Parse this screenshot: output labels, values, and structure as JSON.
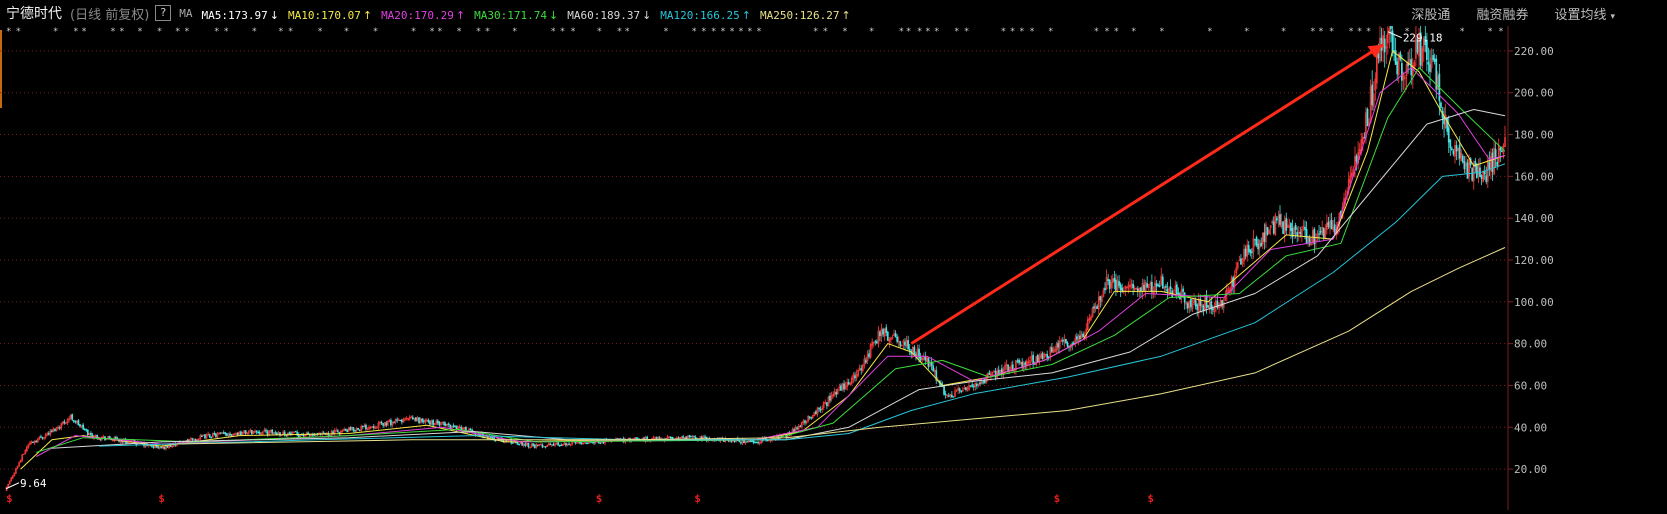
{
  "header": {
    "stock_name": "宁德时代",
    "period_label": "(日线 前复权)",
    "help": "?",
    "ma_label": "MA",
    "ma_items": [
      {
        "label": "MA5:173.97",
        "arrow": "↓",
        "color": "#ffffff"
      },
      {
        "label": "MA10:170.07",
        "arrow": "↑",
        "color": "#f5e94a"
      },
      {
        "label": "MA20:170.29",
        "arrow": "↑",
        "color": "#e040e0"
      },
      {
        "label": "MA30:171.74",
        "arrow": "↓",
        "color": "#3ddc3d"
      },
      {
        "label": "MA60:189.37",
        "arrow": "↓",
        "color": "#d8d8d8"
      },
      {
        "label": "MA120:166.25",
        "arrow": "↑",
        "color": "#26c6da"
      },
      {
        "label": "MA250:126.27",
        "arrow": "↑",
        "color": "#e8e08a"
      }
    ],
    "menu": [
      {
        "label": "深股通"
      },
      {
        "label": "融资融券"
      },
      {
        "label": "设置均线",
        "caret": "▾"
      }
    ]
  },
  "colors": {
    "up": "#ff3b3b",
    "down": "#47e6e6",
    "grid": "#7a1f1f",
    "axis_text": "#bfbfbf",
    "event_marker": "#e02020"
  },
  "chart_data": {
    "type": "line",
    "ylim": [
      10,
      230
    ],
    "yticks": [
      20,
      40,
      60,
      80,
      100,
      120,
      140,
      160,
      180,
      200,
      220
    ],
    "ytick_labels": [
      "20.00",
      "40.00",
      "60.00",
      "80.00",
      "100.00",
      "120.00",
      "140.00",
      "160.00",
      "180.00",
      "200.00",
      "220.00"
    ],
    "x_start": 0,
    "x_end": 1000,
    "price_keypoints": [
      [
        0,
        9.64
      ],
      [
        15,
        32
      ],
      [
        30,
        38
      ],
      [
        42,
        45
      ],
      [
        55,
        36
      ],
      [
        80,
        33
      ],
      [
        100,
        30
      ],
      [
        130,
        36
      ],
      [
        160,
        38
      ],
      [
        200,
        36
      ],
      [
        230,
        40
      ],
      [
        260,
        44
      ],
      [
        290,
        40
      ],
      [
        310,
        35
      ],
      [
        340,
        31
      ],
      [
        370,
        33
      ],
      [
        400,
        34
      ],
      [
        440,
        35
      ],
      [
        480,
        33
      ],
      [
        500,
        36
      ],
      [
        520,
        48
      ],
      [
        545,
        65
      ],
      [
        560,
        86
      ],
      [
        575,
        80
      ],
      [
        590,
        72
      ],
      [
        603,
        55
      ],
      [
        620,
        60
      ],
      [
        640,
        68
      ],
      [
        665,
        74
      ],
      [
        690,
        85
      ],
      [
        705,
        110
      ],
      [
        720,
        105
      ],
      [
        740,
        110
      ],
      [
        760,
        98
      ],
      [
        780,
        100
      ],
      [
        795,
        125
      ],
      [
        815,
        138
      ],
      [
        840,
        130
      ],
      [
        855,
        140
      ],
      [
        870,
        180
      ],
      [
        880,
        220
      ],
      [
        885,
        229.18
      ],
      [
        895,
        205
      ],
      [
        905,
        222
      ],
      [
        915,
        210
      ],
      [
        925,
        175
      ],
      [
        935,
        165
      ],
      [
        945,
        160
      ],
      [
        955,
        170
      ],
      [
        960,
        173
      ]
    ],
    "series": [
      {
        "name": "MA10",
        "color": "#f5e94a",
        "values": [
          [
            10,
            20
          ],
          [
            30,
            34
          ],
          [
            50,
            36
          ],
          [
            100,
            31
          ],
          [
            150,
            36
          ],
          [
            220,
            37
          ],
          [
            270,
            41
          ],
          [
            320,
            33
          ],
          [
            400,
            34
          ],
          [
            480,
            34
          ],
          [
            510,
            38
          ],
          [
            540,
            55
          ],
          [
            565,
            80
          ],
          [
            580,
            76
          ],
          [
            600,
            60
          ],
          [
            630,
            64
          ],
          [
            665,
            72
          ],
          [
            690,
            82
          ],
          [
            710,
            105
          ],
          [
            740,
            105
          ],
          [
            770,
            100
          ],
          [
            795,
            116
          ],
          [
            820,
            132
          ],
          [
            850,
            130
          ],
          [
            872,
            172
          ],
          [
            888,
            220
          ],
          [
            905,
            210
          ],
          [
            920,
            190
          ],
          [
            940,
            165
          ],
          [
            960,
            170
          ]
        ]
      },
      {
        "name": "MA20",
        "color": "#e040e0",
        "values": [
          [
            20,
            26
          ],
          [
            45,
            36
          ],
          [
            100,
            32
          ],
          [
            220,
            36
          ],
          [
            280,
            40
          ],
          [
            330,
            33
          ],
          [
            480,
            34
          ],
          [
            520,
            40
          ],
          [
            565,
            74
          ],
          [
            590,
            74
          ],
          [
            620,
            62
          ],
          [
            665,
            72
          ],
          [
            700,
            86
          ],
          [
            730,
            104
          ],
          [
            780,
            102
          ],
          [
            810,
            125
          ],
          [
            850,
            130
          ],
          [
            880,
            200
          ],
          [
            900,
            212
          ],
          [
            930,
            190
          ],
          [
            950,
            168
          ],
          [
            960,
            170
          ]
        ]
      },
      {
        "name": "MA30",
        "color": "#3ddc3d",
        "values": [
          [
            20,
            28
          ],
          [
            50,
            35
          ],
          [
            120,
            33
          ],
          [
            220,
            36
          ],
          [
            290,
            39
          ],
          [
            340,
            33
          ],
          [
            490,
            34
          ],
          [
            530,
            42
          ],
          [
            570,
            68
          ],
          [
            600,
            72
          ],
          [
            630,
            64
          ],
          [
            670,
            70
          ],
          [
            710,
            84
          ],
          [
            745,
            102
          ],
          [
            790,
            104
          ],
          [
            820,
            122
          ],
          [
            855,
            128
          ],
          [
            885,
            188
          ],
          [
            905,
            212
          ],
          [
            935,
            190
          ],
          [
            960,
            172
          ]
        ]
      },
      {
        "name": "MA60",
        "color": "#d8d8d8",
        "values": [
          [
            30,
            30
          ],
          [
            100,
            33
          ],
          [
            220,
            35
          ],
          [
            300,
            38
          ],
          [
            360,
            34
          ],
          [
            500,
            34
          ],
          [
            540,
            40
          ],
          [
            585,
            58
          ],
          [
            620,
            62
          ],
          [
            670,
            66
          ],
          [
            720,
            76
          ],
          [
            760,
            94
          ],
          [
            800,
            104
          ],
          [
            840,
            122
          ],
          [
            880,
            158
          ],
          [
            910,
            185
          ],
          [
            940,
            192
          ],
          [
            960,
            189
          ]
        ]
      },
      {
        "name": "MA120",
        "color": "#26c6da",
        "values": [
          [
            60,
            31
          ],
          [
            200,
            34
          ],
          [
            300,
            36
          ],
          [
            400,
            34
          ],
          [
            500,
            34
          ],
          [
            540,
            37
          ],
          [
            580,
            48
          ],
          [
            620,
            56
          ],
          [
            680,
            64
          ],
          [
            740,
            74
          ],
          [
            800,
            90
          ],
          [
            850,
            114
          ],
          [
            890,
            138
          ],
          [
            920,
            160
          ],
          [
            945,
            162
          ],
          [
            960,
            166
          ]
        ]
      },
      {
        "name": "MA250",
        "color": "#e8e08a",
        "values": [
          [
            110,
            32
          ],
          [
            260,
            34
          ],
          [
            400,
            34
          ],
          [
            500,
            35
          ],
          [
            560,
            40
          ],
          [
            620,
            44
          ],
          [
            680,
            48
          ],
          [
            740,
            56
          ],
          [
            800,
            66
          ],
          [
            860,
            86
          ],
          [
            900,
            105
          ],
          [
            930,
            116
          ],
          [
            960,
            126
          ]
        ]
      }
    ],
    "annotations": {
      "low": {
        "x": 0,
        "label": "9.64"
      },
      "high": {
        "x": 885,
        "label": "229.18"
      },
      "arrow": {
        "from": [
          580,
          80
        ],
        "to": [
          882,
          223
        ],
        "color": "#ff2a1a"
      }
    },
    "event_markers": {
      "symbol": "$",
      "x": [
        0,
        100,
        380,
        443,
        673,
        733
      ],
      "color": "#e02020"
    },
    "top_markers_symbol": "*"
  }
}
